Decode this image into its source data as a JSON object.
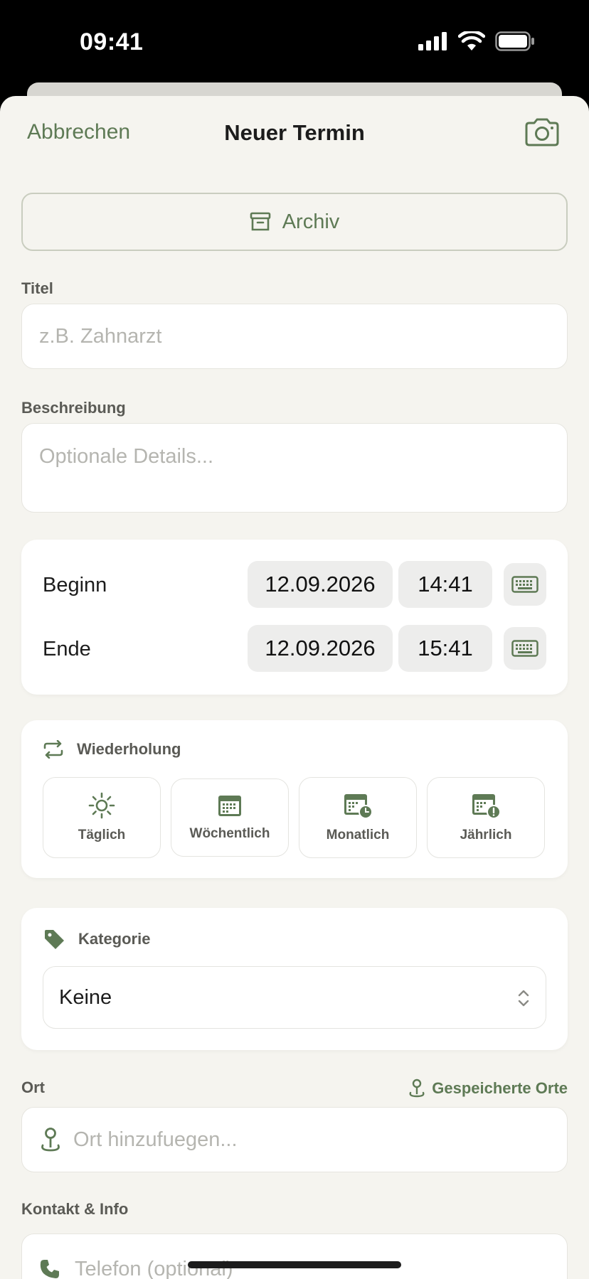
{
  "status": {
    "time": "09:41"
  },
  "nav": {
    "cancel_label": "Abbrechen",
    "title": "Neuer Termin"
  },
  "archive": {
    "label": "Archiv"
  },
  "title_field": {
    "label": "Titel",
    "placeholder": "z.B. Zahnarzt"
  },
  "description_field": {
    "label": "Beschreibung",
    "placeholder": "Optionale Details..."
  },
  "schedule": {
    "start": {
      "label": "Beginn",
      "date": "12.09.2026",
      "time": "14:41"
    },
    "end": {
      "label": "Ende",
      "date": "12.09.2026",
      "time": "15:41"
    }
  },
  "repeat": {
    "title": "Wiederholung",
    "options": [
      {
        "label": "Täglich",
        "icon": "sun-icon"
      },
      {
        "label": "Wöchentlich",
        "icon": "calendar-icon"
      },
      {
        "label": "Monatlich",
        "icon": "calendar-clock-icon"
      },
      {
        "label": "Jährlich",
        "icon": "calendar-alert-icon"
      }
    ]
  },
  "category": {
    "title": "Kategorie",
    "value": "Keine"
  },
  "location": {
    "label": "Ort",
    "saved_label": "Gespeicherte Orte",
    "placeholder": "Ort hinzufuegen..."
  },
  "contact": {
    "label": "Kontakt & Info",
    "phone_placeholder": "Telefon (optional)"
  },
  "colors": {
    "accent": "#5e7a55",
    "background": "#f5f4ef",
    "pill": "#ededec"
  }
}
